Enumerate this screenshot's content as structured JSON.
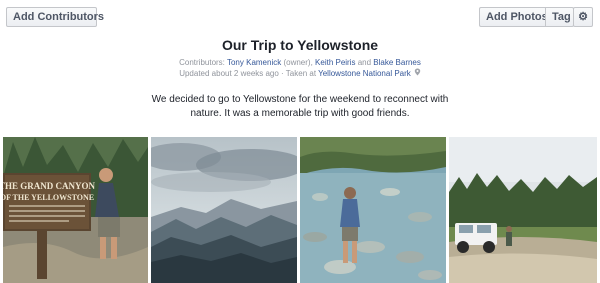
{
  "toolbar": {
    "add_contributors": "Add Contributors",
    "add_photos": "Add Photos",
    "tag": "Tag",
    "settings_icon": "gear-icon"
  },
  "album": {
    "title": "Our Trip to Yellowstone",
    "contributors_prefix": "Contributors: ",
    "contributor_1": "Tony Kamenick",
    "contributor_1_role": " (owner), ",
    "contributor_2": "Keith Peiris",
    "and_text": " and ",
    "contributor_3": "Blake Barnes",
    "updated": "Updated about 2 weeks ago · Taken at ",
    "location": "Yellowstone National Park",
    "location_icon": "map-pin-icon",
    "description": "We decided to go to Yellowstone for the weekend to reconnect with nature. It was a memorable trip with good friends.",
    "sign_line_1": "THE GRAND CANYON",
    "sign_line_2": "OF THE YELLOWSTONE"
  }
}
